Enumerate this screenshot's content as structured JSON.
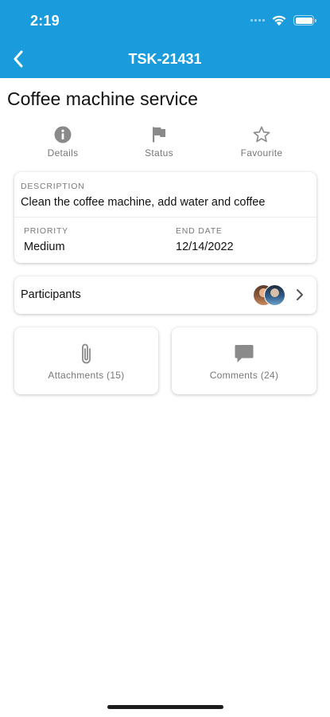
{
  "status_bar": {
    "time": "2:19"
  },
  "nav": {
    "title": "TSK-21431"
  },
  "task": {
    "title": "Coffee machine service"
  },
  "tabs": [
    {
      "label": "Details",
      "icon": "info-icon"
    },
    {
      "label": "Status",
      "icon": "flag-icon"
    },
    {
      "label": "Favourite",
      "icon": "star-outline-icon"
    }
  ],
  "details": {
    "description_label": "DESCRIPTION",
    "description": "Clean the coffee machine, add water and coffee",
    "priority_label": "PRIORITY",
    "priority": "Medium",
    "end_date_label": "END DATE",
    "end_date": "12/14/2022"
  },
  "participants": {
    "label": "Participants"
  },
  "tiles": {
    "attachments_label": "Attachments (15)",
    "comments_label": "Comments (24)"
  },
  "colors": {
    "header": "#1a9bdb",
    "icon_grey": "#8a8a8a",
    "caption_grey": "#777777"
  }
}
